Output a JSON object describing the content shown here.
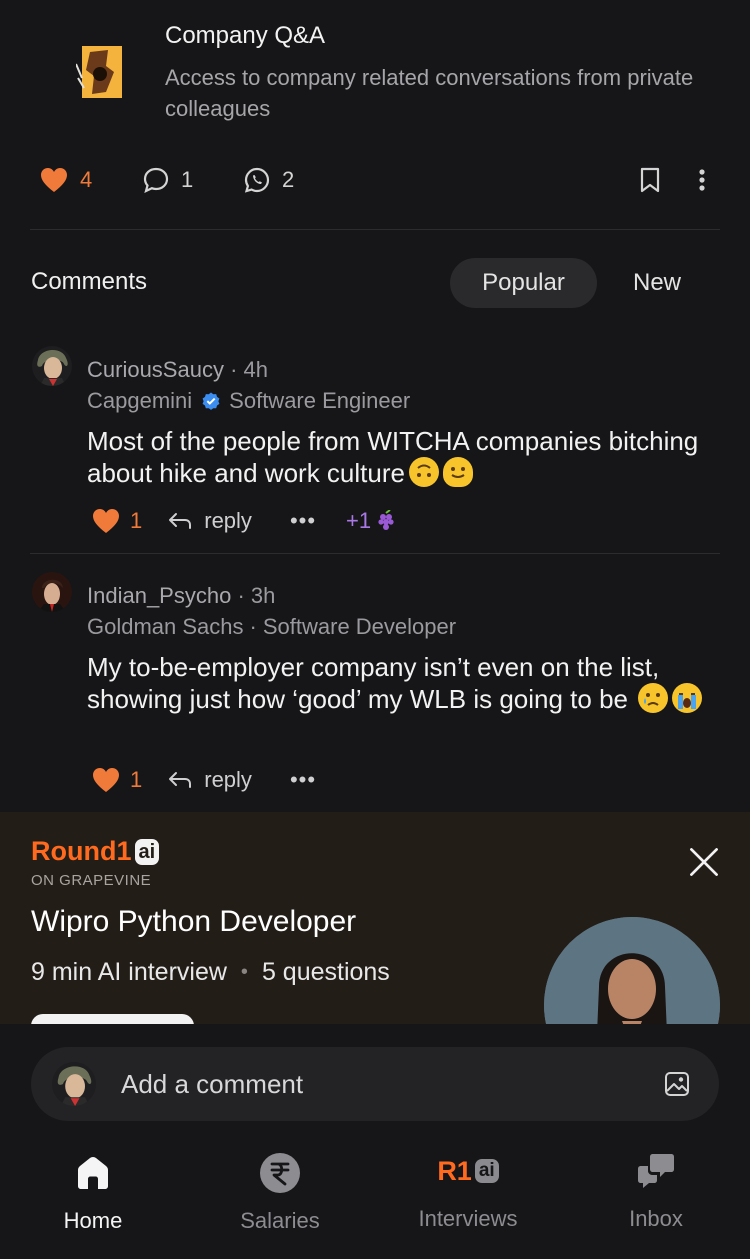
{
  "post": {
    "title": "Company Q&A",
    "description": "Access to company related conversations from private colleagues",
    "likes": "4",
    "comments": "1",
    "shares": "2"
  },
  "comments_section": {
    "label": "Comments",
    "sort_popular": "Popular",
    "sort_new": "New"
  },
  "comments": [
    {
      "username": "CuriousSaucy",
      "time": "4h",
      "company": "Capgemini",
      "role": "Software Engineer",
      "text": "Most of the people from WITCHA companies bitching about hike and work culture",
      "likes": "1",
      "reply": "reply",
      "extra_reactions": "+1"
    },
    {
      "username": "Indian_Psycho",
      "time": "3h",
      "company": "Goldman Sachs",
      "role": "Software Developer",
      "text": "My to-be-employer company isn’t even on the list, showing just how ‘good’ my WLB is going to be",
      "likes": "1",
      "reply": "reply"
    }
  ],
  "meta_sep": "·",
  "ad": {
    "brand": "Round1",
    "brand_badge": "ai",
    "subtitle": "ON GRAPEVINE",
    "title": "Wipro Python Developer",
    "duration": "9 min AI interview",
    "questions": "5 questions"
  },
  "comment_input": {
    "placeholder": "Add a comment"
  },
  "nav": {
    "home": "Home",
    "salaries": "Salaries",
    "interviews": "Interviews",
    "interviews_logo": "R1",
    "interviews_badge": "ai",
    "inbox": "Inbox"
  },
  "colors": {
    "background": "#161618",
    "accent_orange": "#f07a3a",
    "brand_orange": "#ff6a1f",
    "verified_blue": "#3b8ef0",
    "reaction_purple": "#a977e6"
  }
}
